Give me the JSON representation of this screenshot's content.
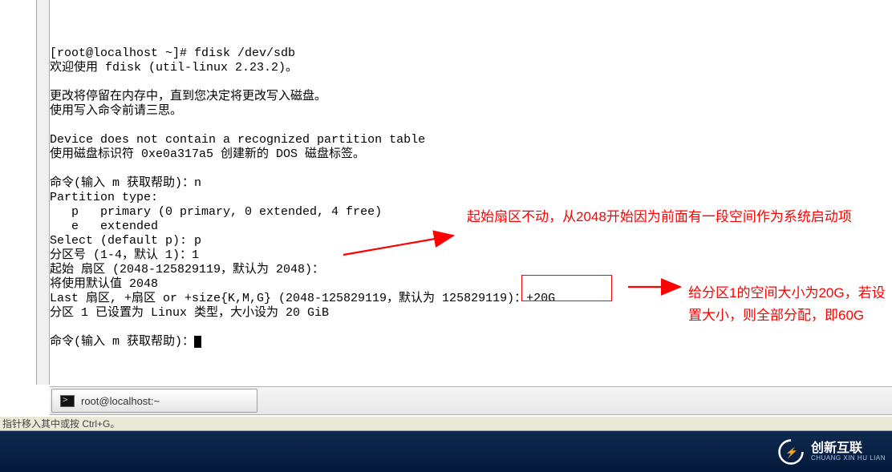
{
  "terminal": {
    "lines": [
      "",
      "[root@localhost ~]# fdisk /dev/sdb",
      "欢迎使用 fdisk (util-linux 2.23.2)。",
      "",
      "更改将停留在内存中，直到您决定将更改写入磁盘。",
      "使用写入命令前请三思。",
      "",
      "Device does not contain a recognized partition table",
      "使用磁盘标识符 0xe0a317a5 创建新的 DOS 磁盘标签。",
      "",
      "命令(输入 m 获取帮助)：n",
      "Partition type:",
      "   p   primary (0 primary, 0 extended, 4 free)",
      "   e   extended",
      "Select (default p): p",
      "分区号 (1-4，默认 1)：1",
      "起始 扇区 (2048-125829119，默认为 2048)：",
      "将使用默认值 2048",
      "Last 扇区, +扇区 or +size{K,M,G} (2048-125829119，默认为 125829119)：+20G",
      "分区 1 已设置为 Linux 类型，大小设为 20 GiB",
      "",
      "命令(输入 m 获取帮助)："
    ]
  },
  "annotation1": "起始扇区不动，从2048开始因为前面有一段空间作为系统启动项",
  "annotation2": "给分区1的空间大小为20G，若设置大小，则全部分配，即60G",
  "boxed_value": "：+20G",
  "taskbar": {
    "item1": "root@localhost:~"
  },
  "hint": "指针移入其中或按 Ctrl+G。",
  "brand": {
    "cn": "创新互联",
    "en": "CHUANG XIN HU LIAN"
  },
  "colors": {
    "annotation": "#ff0000",
    "bottom_bg_top": "#0e2a4f",
    "bottom_bg_bottom": "#04193b"
  }
}
